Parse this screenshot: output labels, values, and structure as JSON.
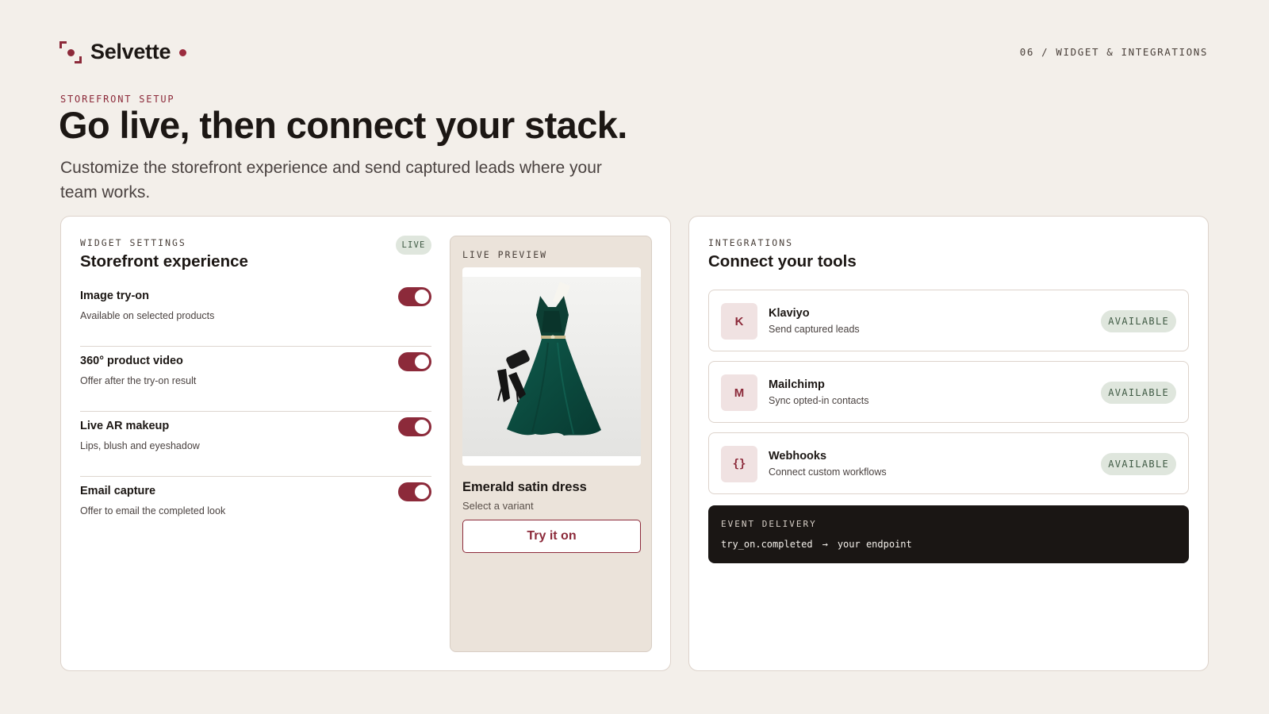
{
  "brand": {
    "name": "Selvette"
  },
  "page_counter": "06 / WIDGET & INTEGRATIONS",
  "hero": {
    "eyebrow": "STOREFRONT SETUP",
    "title": "Go live, then connect your stack.",
    "subtitle": "Customize the storefront experience and send captured leads where your team works."
  },
  "widget": {
    "section_label": "WIDGET SETTINGS",
    "title": "Storefront experience",
    "status_badge": "LIVE",
    "settings": [
      {
        "title": "Image try-on",
        "description": "Available on selected products",
        "enabled": true
      },
      {
        "title": "360° product video",
        "description": "Offer after the try-on result",
        "enabled": true
      },
      {
        "title": "Live AR makeup",
        "description": "Lips, blush and eyeshadow",
        "enabled": true
      },
      {
        "title": "Email capture",
        "description": "Offer to email the completed look",
        "enabled": true
      }
    ]
  },
  "preview": {
    "label": "LIVE PREVIEW",
    "product_name": "Emerald satin dress",
    "variant_prompt": "Select a variant",
    "cta": "Try it on"
  },
  "integrations": {
    "section_label": "INTEGRATIONS",
    "title": "Connect your tools",
    "items": [
      {
        "icon": "K",
        "name": "Klaviyo",
        "description": "Send captured leads",
        "status": "AVAILABLE"
      },
      {
        "icon": "M",
        "name": "Mailchimp",
        "description": "Sync opted-in contacts",
        "status": "AVAILABLE"
      },
      {
        "icon": "{}",
        "name": "Webhooks",
        "description": "Connect custom workflows",
        "status": "AVAILABLE"
      }
    ],
    "event_delivery": {
      "label": "EVENT DELIVERY",
      "event": "try_on.completed",
      "arrow": "→",
      "destination": "your endpoint"
    }
  },
  "colors": {
    "accent": "#8c2a3a",
    "background": "#f3efea",
    "badge_bg": "#dfe6dd",
    "badge_text": "#3f5a44",
    "dark_panel": "#1a1614"
  }
}
